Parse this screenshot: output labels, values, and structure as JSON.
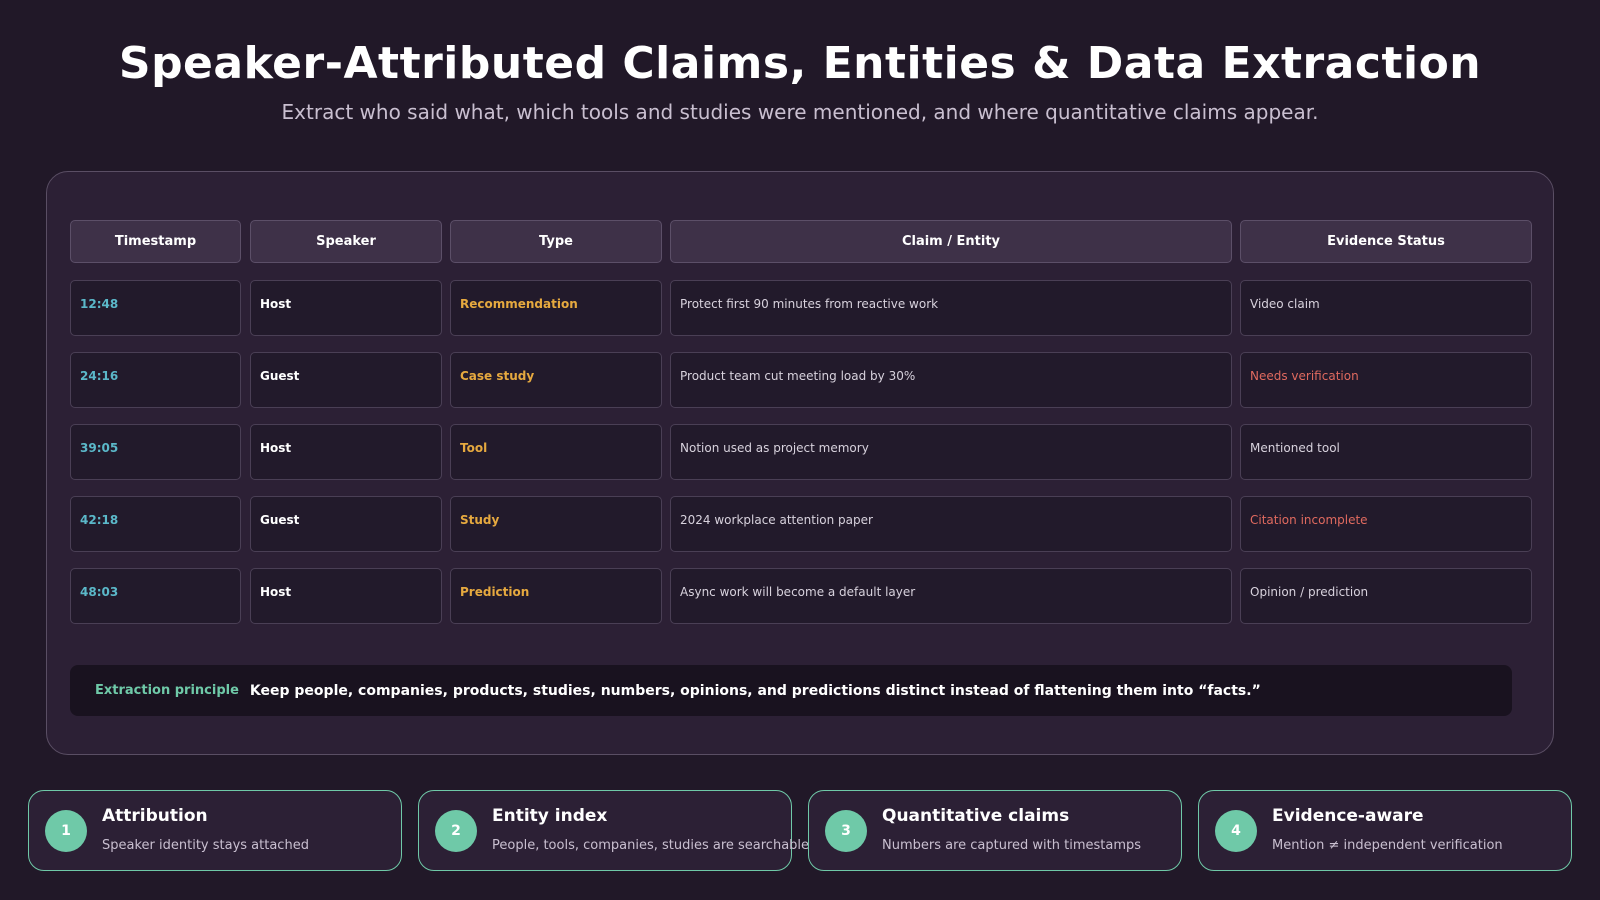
{
  "header": {
    "title": "Speaker-Attributed Claims, Entities & Data Extraction",
    "subtitle": "Extract who said what, which tools and studies were mentioned, and where quantitative claims appear."
  },
  "table": {
    "columns": [
      "Timestamp",
      "Speaker",
      "Type",
      "Claim / Entity",
      "Evidence Status"
    ],
    "rows": [
      {
        "timestamp": "12:48",
        "speaker": "Host",
        "type": "Recommendation",
        "claim": "Protect first 90 minutes from reactive work",
        "status": "Video claim",
        "status_flag": "normal"
      },
      {
        "timestamp": "24:16",
        "speaker": "Guest",
        "type": "Case study",
        "claim": "Product team cut meeting load by 30%",
        "status": "Needs verification",
        "status_flag": "warning"
      },
      {
        "timestamp": "39:05",
        "speaker": "Host",
        "type": "Tool",
        "claim": "Notion used as project memory",
        "status": "Mentioned tool",
        "status_flag": "normal"
      },
      {
        "timestamp": "42:18",
        "speaker": "Guest",
        "type": "Study",
        "claim": "2024 workplace attention paper",
        "status": "Citation incomplete",
        "status_flag": "warning"
      },
      {
        "timestamp": "48:03",
        "speaker": "Host",
        "type": "Prediction",
        "claim": "Async work will become a default layer",
        "status": "Opinion / prediction",
        "status_flag": "normal"
      }
    ]
  },
  "principle": {
    "label": "Extraction principle",
    "text": "Keep people, companies, products, studies, numbers, opinions, and predictions distinct instead of flattening them into “facts.”"
  },
  "cards": [
    {
      "number": "1",
      "title": "Attribution",
      "description": "Speaker identity stays attached"
    },
    {
      "number": "2",
      "title": "Entity index",
      "description": "People, tools, companies, studies are searchable"
    },
    {
      "number": "3",
      "title": "Quantitative claims",
      "description": "Numbers are captured with timestamps"
    },
    {
      "number": "4",
      "title": "Evidence-aware",
      "description": "Mention ≠ independent verification"
    }
  ],
  "colors": {
    "background": "#211828",
    "accent_teal": "#6fc9a8",
    "timestamp": "#5bb8c9",
    "type": "#e6a93f",
    "warning": "#e06a5f"
  }
}
